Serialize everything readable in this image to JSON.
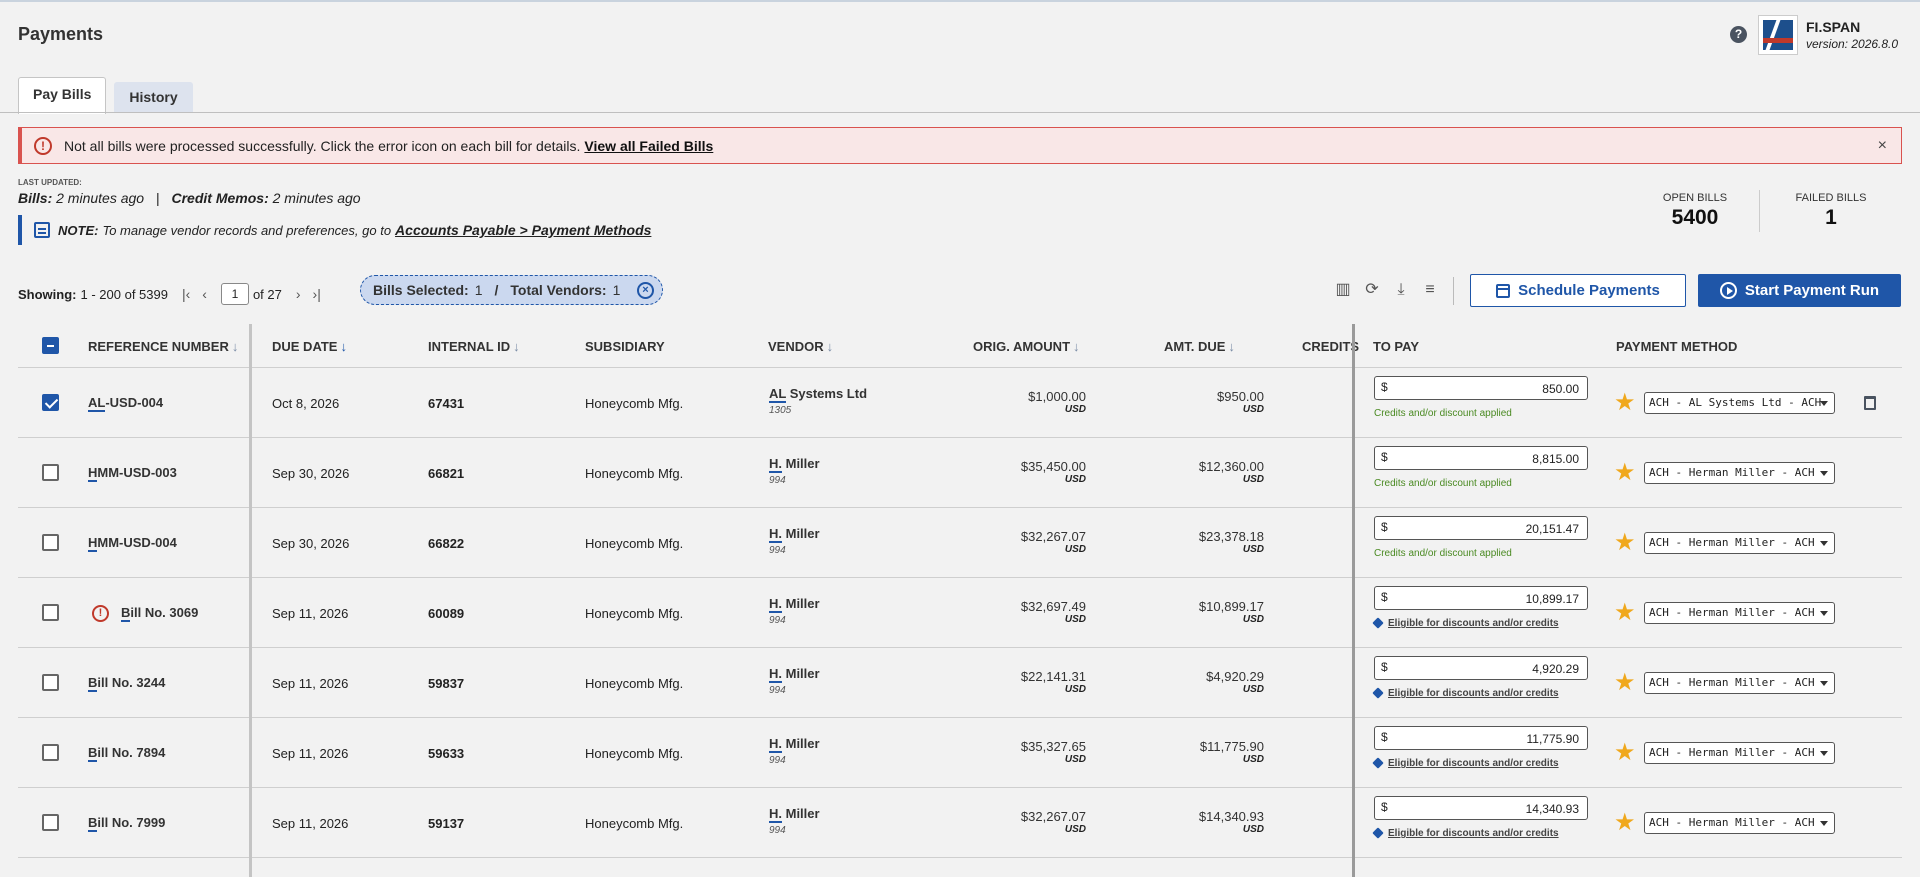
{
  "header": {
    "title": "Payments",
    "brand_name": "FI.SPAN",
    "brand_version": "version: 2026.8.0",
    "help_icon": "question-circle-icon"
  },
  "tabs": [
    {
      "label": "Pay Bills",
      "active": true
    },
    {
      "label": "History",
      "active": false
    }
  ],
  "alert": {
    "message": "Not all bills were processed successfully. Click the error icon on each bill for details.",
    "link": "View all Failed Bills",
    "close": "×"
  },
  "updated": {
    "label": "LAST UPDATED:",
    "bills_label": "Bills:",
    "bills_value": "2 minutes ago",
    "sep": "|",
    "memos_label": "Credit Memos:",
    "memos_value": "2 minutes ago"
  },
  "note": {
    "label": "NOTE:",
    "text": "To manage vendor records and preferences, go to",
    "link": "Accounts Payable > Payment Methods"
  },
  "stats": {
    "open_label": "OPEN BILLS",
    "open_value": "5400",
    "failed_label": "FAILED BILLS",
    "failed_value": "1"
  },
  "pagination": {
    "showing_label": "Showing:",
    "showing_value": "1 - 200 of 5399",
    "page": "1",
    "of_pages": "of 27"
  },
  "selection": {
    "bills_label": "Bills Selected:",
    "bills_value": "1",
    "sep": "/",
    "vendors_label": "Total Vendors:",
    "vendors_value": "1"
  },
  "actions": {
    "schedule": "Schedule Payments",
    "start_run": "Start Payment Run"
  },
  "table": {
    "columns": {
      "reference": "REFERENCE NUMBER",
      "due_date": "DUE DATE",
      "internal_id": "INTERNAL ID",
      "subsidiary": "SUBSIDIARY",
      "vendor": "VENDOR",
      "orig_amount": "ORIG. AMOUNT",
      "amt_due": "AMT. DUE",
      "credits": "CREDITS",
      "to_pay": "TO PAY",
      "payment_method": "PAYMENT METHOD"
    },
    "rows": [
      {
        "checked": true,
        "ref_prefix": "AL",
        "ref_rest": "-USD-004",
        "error": false,
        "due": "Oct 8, 2026",
        "internal_id": "67431",
        "subsidiary": "Honeycomb Mfg.",
        "vendor_prefix": "AL",
        "vendor_rest": " Systems Ltd",
        "vendor_id": "1305",
        "orig": "$1,000.00",
        "due_amt": "$950.00",
        "currency": "USD",
        "dollar": "$",
        "to_pay": "850.00",
        "pay_note": "Credits and/or discount applied",
        "pay_note_type": "green",
        "method": "ACH - AL Systems Ltd - ACH",
        "trash": true
      },
      {
        "checked": false,
        "ref_prefix": "H",
        "ref_rest": "MM-USD-003",
        "error": false,
        "due": "Sep 30, 2026",
        "internal_id": "66821",
        "subsidiary": "Honeycomb Mfg.",
        "vendor_prefix": "H.",
        "vendor_rest": " Miller",
        "vendor_id": "994",
        "orig": "$35,450.00",
        "due_amt": "$12,360.00",
        "currency": "USD",
        "dollar": "$",
        "to_pay": "8,815.00",
        "pay_note": "Credits and/or discount applied",
        "pay_note_type": "green",
        "method": "ACH - Herman Miller - ACH",
        "trash": false
      },
      {
        "checked": false,
        "ref_prefix": "H",
        "ref_rest": "MM-USD-004",
        "error": false,
        "due": "Sep 30, 2026",
        "internal_id": "66822",
        "subsidiary": "Honeycomb Mfg.",
        "vendor_prefix": "H.",
        "vendor_rest": " Miller",
        "vendor_id": "994",
        "orig": "$32,267.07",
        "due_amt": "$23,378.18",
        "currency": "USD",
        "dollar": "$",
        "to_pay": "20,151.47",
        "pay_note": "Credits and/or discount applied",
        "pay_note_type": "green",
        "method": "ACH - Herman Miller - ACH",
        "trash": false
      },
      {
        "checked": false,
        "ref_prefix": "B",
        "ref_rest": "ill No. 3069",
        "error": true,
        "due": "Sep 11, 2026",
        "internal_id": "60089",
        "subsidiary": "Honeycomb Mfg.",
        "vendor_prefix": "H.",
        "vendor_rest": " Miller",
        "vendor_id": "994",
        "orig": "$32,697.49",
        "due_amt": "$10,899.17",
        "currency": "USD",
        "dollar": "$",
        "to_pay": "10,899.17",
        "pay_note": "Eligible for discounts and/or credits",
        "pay_note_type": "link",
        "method": "ACH - Herman Miller - ACH",
        "trash": false
      },
      {
        "checked": false,
        "ref_prefix": "B",
        "ref_rest": "ill No. 3244",
        "error": false,
        "due": "Sep 11, 2026",
        "internal_id": "59837",
        "subsidiary": "Honeycomb Mfg.",
        "vendor_prefix": "H.",
        "vendor_rest": " Miller",
        "vendor_id": "994",
        "orig": "$22,141.31",
        "due_amt": "$4,920.29",
        "currency": "USD",
        "dollar": "$",
        "to_pay": "4,920.29",
        "pay_note": "Eligible for discounts and/or credits",
        "pay_note_type": "link",
        "method": "ACH - Herman Miller - ACH",
        "trash": false
      },
      {
        "checked": false,
        "ref_prefix": "B",
        "ref_rest": "ill No. 7894",
        "error": false,
        "due": "Sep 11, 2026",
        "internal_id": "59633",
        "subsidiary": "Honeycomb Mfg.",
        "vendor_prefix": "H.",
        "vendor_rest": " Miller",
        "vendor_id": "994",
        "orig": "$35,327.65",
        "due_amt": "$11,775.90",
        "currency": "USD",
        "dollar": "$",
        "to_pay": "11,775.90",
        "pay_note": "Eligible for discounts and/or credits",
        "pay_note_type": "link",
        "method": "ACH - Herman Miller - ACH",
        "trash": false
      },
      {
        "checked": false,
        "ref_prefix": "B",
        "ref_rest": "ill No. 7999",
        "error": false,
        "due": "Sep 11, 2026",
        "internal_id": "59137",
        "subsidiary": "Honeycomb Mfg.",
        "vendor_prefix": "H.",
        "vendor_rest": " Miller",
        "vendor_id": "994",
        "orig": "$32,267.07",
        "due_amt": "$14,340.93",
        "currency": "USD",
        "dollar": "$",
        "to_pay": "14,340.93",
        "pay_note": "Eligible for discounts and/or credits",
        "pay_note_type": "link",
        "method": "ACH - Herman Miller - ACH",
        "trash": false
      }
    ]
  },
  "colors": {
    "primary": "#1f56a8",
    "error": "#c0392b",
    "alert_bg": "#f9e7e7",
    "success": "#4a8a22",
    "star": "#f0a81c"
  }
}
